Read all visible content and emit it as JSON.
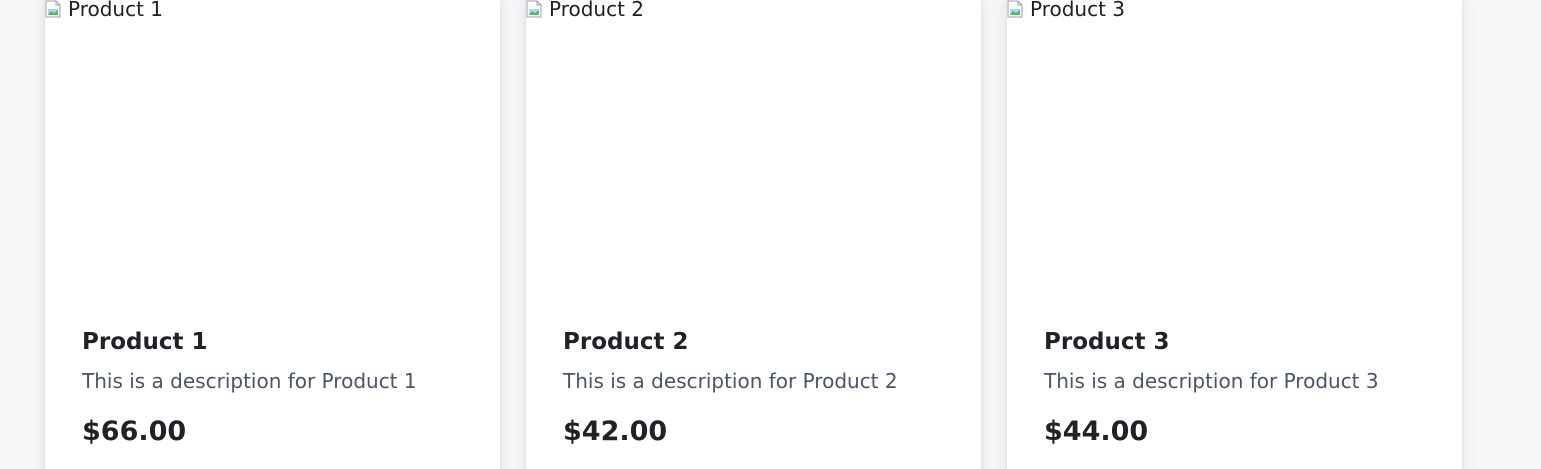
{
  "products": [
    {
      "image_alt": "Product 1",
      "title": "Product 1",
      "description": "This is a description for Product 1",
      "price": "$66.00"
    },
    {
      "image_alt": "Product 2",
      "title": "Product 2",
      "description": "This is a description for Product 2",
      "price": "$42.00"
    },
    {
      "image_alt": "Product 3",
      "title": "Product 3",
      "description": "This is a description for Product 3",
      "price": "$44.00"
    }
  ],
  "icons": {
    "broken_image": "broken-image-icon"
  },
  "colors": {
    "page_background": "#f7f8fa",
    "card_background": "#ffffff",
    "title_text": "#1f2328",
    "description_text": "#4b5563"
  }
}
